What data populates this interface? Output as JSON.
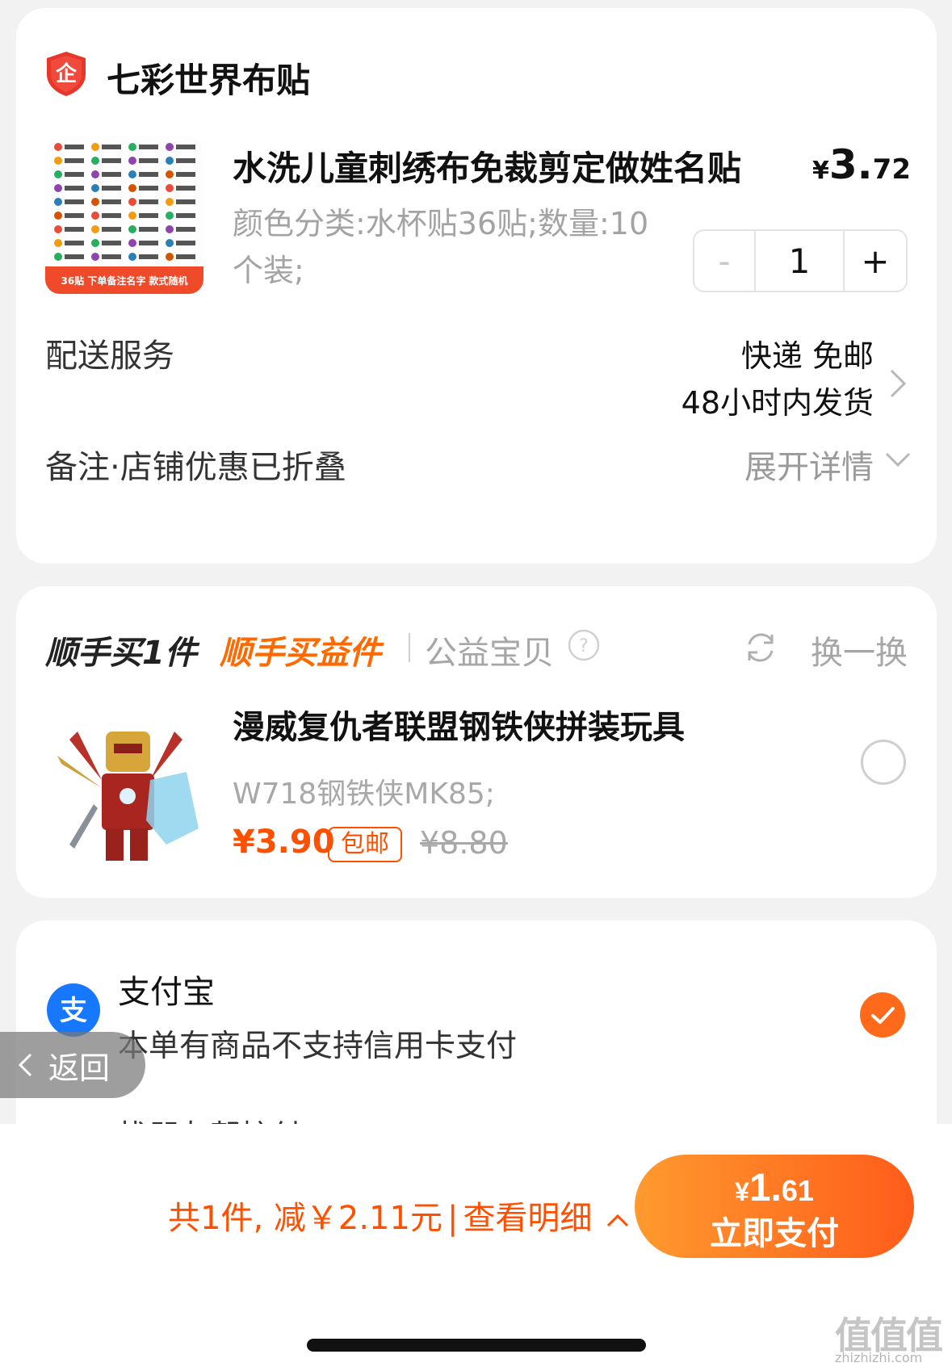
{
  "shop": {
    "name": "七彩世界布贴",
    "badge_icon": "enterprise-shield-icon",
    "badge_text": "企"
  },
  "product": {
    "title": "水洗儿童刺绣布免裁剪定做姓名贴",
    "price_currency": "¥",
    "price_int": "3.",
    "price_dec": "72",
    "sku": "颜色分类:水杯贴36贴;数量:10个装;",
    "thumb_banner": "36贴 下单备注名字 款式随机",
    "quantity": {
      "minus": "-",
      "value": "1",
      "plus": "+"
    }
  },
  "delivery": {
    "label": "配送服务",
    "line1": "快递 免邮",
    "line2": "48小时内发货"
  },
  "remark": {
    "label": "备注·店铺优惠已折叠",
    "expand": "展开详情"
  },
  "addon": {
    "heading1": "顺手买1件",
    "heading2": "顺手买益件",
    "heading3": "公益宝贝",
    "refresh": "换一换",
    "item_title": "漫威复仇者联盟钢铁侠拼装玩具",
    "item_sku": "W718钢铁侠MK85;",
    "item_price": "¥3.90",
    "item_tag": "包邮",
    "item_old_price": "¥8.80"
  },
  "payment": {
    "method": "支付宝",
    "icon_text": "支",
    "note": "本单有商品不支持信用卡支付",
    "partial_option": "找朋友帮忙付"
  },
  "back": {
    "label": "返回"
  },
  "footer": {
    "summary": "共1件, 减￥2.11元",
    "sep": "|",
    "detail_link": "查看明细",
    "pay_currency": "¥",
    "pay_int": "1.",
    "pay_dec": "61",
    "pay_label": "立即支付",
    "watermark": "值值值",
    "watermark_sub": "zhizhizhi.com"
  },
  "colors": {
    "accent": "#ff5000",
    "alipay_blue": "#1677ff",
    "check_orange": "#ff6a1a"
  }
}
